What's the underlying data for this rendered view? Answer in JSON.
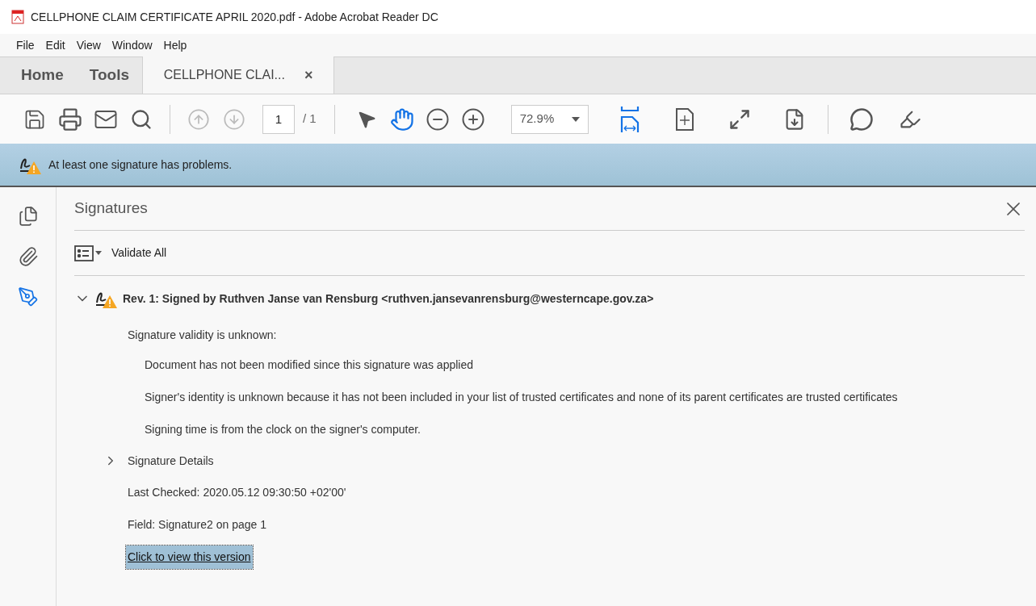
{
  "window": {
    "title": "CELLPHONE CLAIM CERTIFICATE APRIL 2020.pdf - Adobe Acrobat Reader DC"
  },
  "menu": [
    "File",
    "Edit",
    "View",
    "Window",
    "Help"
  ],
  "tabs": [
    {
      "label": "Home",
      "kind": "nav",
      "selected": false
    },
    {
      "label": "Tools",
      "kind": "nav",
      "selected": false
    },
    {
      "label": "CELLPHONE CLAI...",
      "kind": "document",
      "selected": true,
      "close": "×"
    }
  ],
  "toolbar": {
    "page": "1",
    "page_total": "/ 1",
    "zoom": "72.9%"
  },
  "notice": {
    "text": "At least one signature has problems."
  },
  "side_rail": [
    {
      "kind": "pages",
      "selected": false
    },
    {
      "kind": "attachments",
      "selected": false
    },
    {
      "kind": "signatures",
      "selected": true
    }
  ],
  "panel": {
    "title": "Signatures",
    "validate_all": "Validate All",
    "signature": {
      "header": "Rev. 1: Signed by Ruthven Janse van Rensburg <ruthven.jansevanrensburg@westerncape.gov.za>",
      "expanded": true,
      "validity": "Signature validity is unknown:",
      "reasons": [
        "Document has not been modified since this signature was applied",
        "Signer's identity is unknown because it has not been included in your list of trusted certificates and none of its parent certificates are trusted certificates",
        "Signing time is from the clock on the signer's computer."
      ],
      "details": {
        "label": "Signature Details",
        "expanded": false
      },
      "last_checked": "Last Checked: 2020.05.12 09:30:50 +02'00'",
      "field": "Field: Signature2 on page 1",
      "link": {
        "label": "Click to view this version",
        "selected": true
      }
    }
  }
}
